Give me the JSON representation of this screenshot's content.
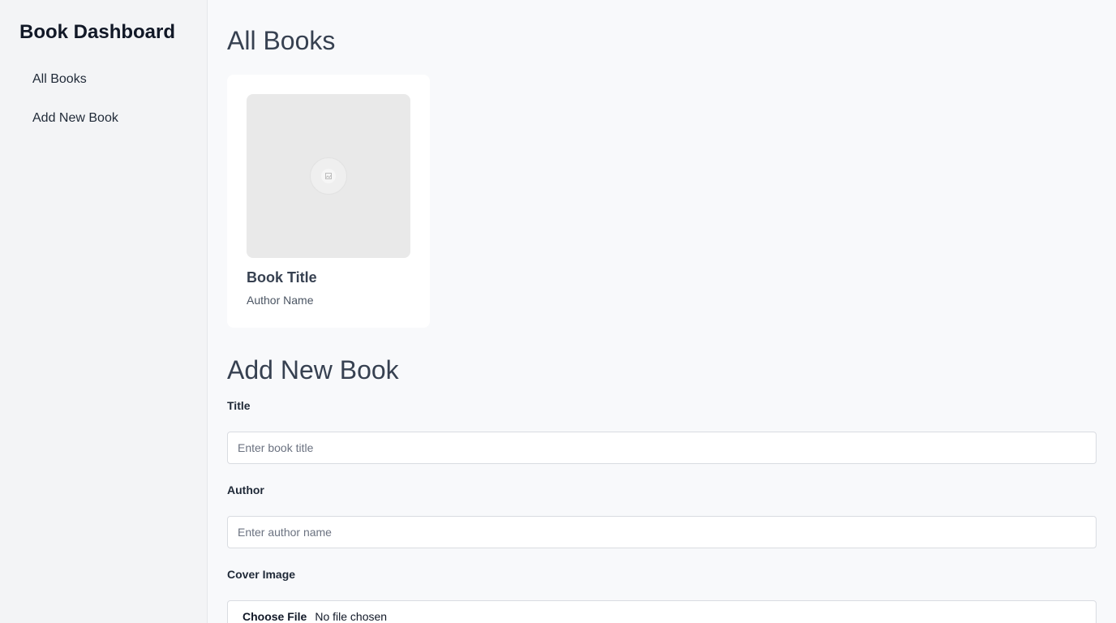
{
  "sidebar": {
    "title": "Book Dashboard",
    "items": [
      {
        "label": "All Books"
      },
      {
        "label": "Add New Book"
      }
    ]
  },
  "main": {
    "all_books_heading": "All Books",
    "books": [
      {
        "title": "Book Title",
        "author": "Author Name",
        "cover_icon": "image-placeholder-icon"
      }
    ],
    "add_book_heading": "Add New Book",
    "form": {
      "title_label": "Title",
      "title_placeholder": "Enter book title",
      "author_label": "Author",
      "author_placeholder": "Enter author name",
      "cover_label": "Cover Image",
      "file_button": "Choose File",
      "file_status": "No file chosen"
    }
  },
  "colors": {
    "sidebar_bg": "#f3f4f6",
    "main_bg": "#f8f9fb",
    "card_bg": "#ffffff",
    "cover_placeholder": "#e9e9e9"
  }
}
